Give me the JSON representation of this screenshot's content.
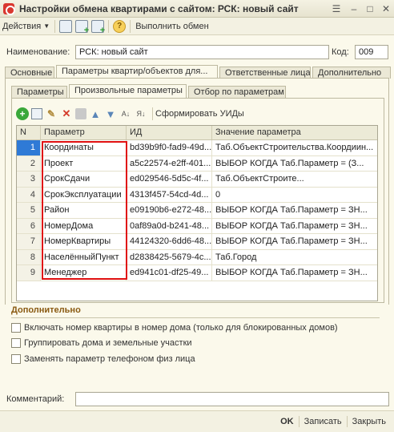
{
  "window": {
    "title": "Настройки обмена квартирами с сайтом: РСК: новый сайт"
  },
  "toolbar": {
    "actions_label": "Действия",
    "run_exchange_label": "Выполнить обмен",
    "help_glyph": "?"
  },
  "form": {
    "name_label": "Наименование:",
    "name_value": "РСК: новый сайт",
    "code_label": "Код:",
    "code_value": "009"
  },
  "main_tabs": [
    "Основные",
    "Параметры квартир/объектов для...",
    "Ответственные лица",
    "Дополнительно"
  ],
  "sub_tabs": [
    "Параметры",
    "Произвольные параметры",
    "Отбор по параметрам"
  ],
  "grid_toolbar": {
    "generate_ids_label": "Сформировать УИДы"
  },
  "grid": {
    "columns": [
      "N",
      "Параметр",
      "ИД",
      "Значение параметра"
    ],
    "rows": [
      {
        "n": "1",
        "param": "Координаты",
        "id": "bd39b9f0-fad9-49d...",
        "value": "Таб.ОбъектСтроительства.Коордиин..."
      },
      {
        "n": "2",
        "param": "Проект",
        "id": "a5c22574-e2ff-401...",
        "value": "ВЫБОР КОГДА Таб.Параметр = (З..."
      },
      {
        "n": "3",
        "param": "СрокСдачи",
        "id": "ed029546-5d5c-4f...",
        "value": "Таб.ОбъектСтроите..."
      },
      {
        "n": "4",
        "param": "СрокЭксплуатации",
        "id": "4313f457-54cd-4d...",
        "value": "0"
      },
      {
        "n": "5",
        "param": "Район",
        "id": "e09190b6-e272-48...",
        "value": "ВЫБОР КОГДА Таб.Параметр = ЗН..."
      },
      {
        "n": "6",
        "param": "НомерДома",
        "id": "0af89a0d-b241-48...",
        "value": "ВЫБОР КОГДА Таб.Параметр = ЗН..."
      },
      {
        "n": "7",
        "param": "НомерКвартиры",
        "id": "44124320-6dd6-48...",
        "value": "ВЫБОР КОГДА Таб.Параметр = ЗН..."
      },
      {
        "n": "8",
        "param": "НаселённыйПункт",
        "id": "d2838425-5679-4c...",
        "value": "Таб.Город"
      },
      {
        "n": "9",
        "param": "Менеджер",
        "id": "ed941c01-df25-49...",
        "value": "ВЫБОР КОГДА Таб.Параметр = ЗН..."
      }
    ]
  },
  "additional": {
    "title": "Дополнительно",
    "checkboxes": [
      "Включать номер квартиры в номер дома (только для блокированных домов)",
      "Группировать дома и земельные участки",
      "Заменять параметр телефоном физ лица"
    ]
  },
  "comment": {
    "label": "Комментарий:",
    "value": ""
  },
  "buttons": {
    "ok": "OK",
    "save": "Записать",
    "close": "Закрыть"
  }
}
